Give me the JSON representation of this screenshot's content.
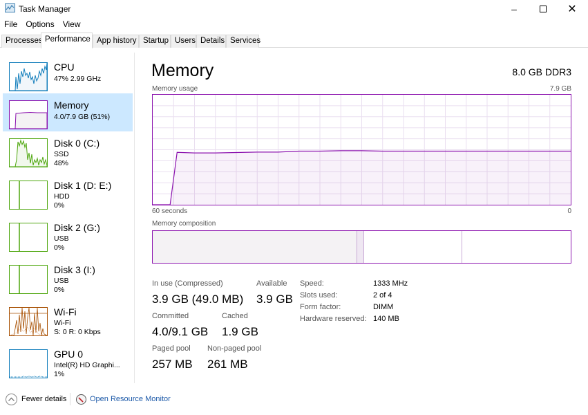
{
  "window": {
    "title": "Task Manager",
    "controls": [
      "minimize",
      "maximize",
      "close"
    ]
  },
  "menu": [
    "File",
    "Options",
    "View"
  ],
  "tabs": [
    {
      "label": "Processes",
      "active": false
    },
    {
      "label": "Performance",
      "active": true
    },
    {
      "label": "App history",
      "active": false
    },
    {
      "label": "Startup",
      "active": false
    },
    {
      "label": "Users",
      "active": false
    },
    {
      "label": "Details",
      "active": false
    },
    {
      "label": "Services",
      "active": false
    }
  ],
  "sidebar": {
    "items": [
      {
        "title": "CPU",
        "line1": "47% 2.99 GHz",
        "line2": "",
        "color": "#117dbb",
        "active": false
      },
      {
        "title": "Memory",
        "line1": "4.0/7.9 GB (51%)",
        "line2": "",
        "color": "#8b12ae",
        "active": true
      },
      {
        "title": "Disk 0 (C:)",
        "line1": "SSD",
        "line2": "48%",
        "color": "#4da60c",
        "active": false
      },
      {
        "title": "Disk 1 (D: E:)",
        "line1": "HDD",
        "line2": "0%",
        "color": "#4da60c",
        "active": false
      },
      {
        "title": "Disk 2 (G:)",
        "line1": "USB",
        "line2": "0%",
        "color": "#4da60c",
        "active": false
      },
      {
        "title": "Disk 3 (I:)",
        "line1": "USB",
        "line2": "0%",
        "color": "#4da60c",
        "active": false
      },
      {
        "title": "Wi-Fi",
        "line1": "Wi-Fi",
        "line2": "S: 0 R: 0 Kbps",
        "color": "#a74f01",
        "active": false
      },
      {
        "title": "GPU 0",
        "line1": "Intel(R) HD Graphi...",
        "line2": "1%",
        "color": "#117dbb",
        "active": false
      }
    ]
  },
  "main": {
    "title": "Memory",
    "spec": "8.0 GB DDR3",
    "usage_label": "Memory usage",
    "usage_max": "7.9 GB",
    "axis_left": "60 seconds",
    "axis_right": "0",
    "composition_label": "Memory composition",
    "stats": {
      "in_use_label": "In use (Compressed)",
      "in_use_value": "3.9 GB (49.0 MB)",
      "available_label": "Available",
      "available_value": "3.9 GB",
      "committed_label": "Committed",
      "committed_value": "4.0/9.1 GB",
      "cached_label": "Cached",
      "cached_value": "1.9 GB",
      "paged_label": "Paged pool",
      "paged_value": "257 MB",
      "nonpaged_label": "Non-paged pool",
      "nonpaged_value": "261 MB"
    },
    "details": [
      {
        "label": "Speed:",
        "value": "1333 MHz"
      },
      {
        "label": "Slots used:",
        "value": "2 of 4"
      },
      {
        "label": "Form factor:",
        "value": "DIMM"
      },
      {
        "label": "Hardware reserved:",
        "value": "140 MB"
      }
    ],
    "accent": "#8b12ae"
  },
  "footer": {
    "fewer_details": "Fewer details",
    "resource_monitor": "Open Resource Monitor"
  },
  "chart_data": {
    "type": "area",
    "title": "Memory usage",
    "xlabel": "60 seconds",
    "ylabel": "",
    "xlim": [
      60,
      0
    ],
    "ylim": [
      0,
      7.9
    ],
    "grid": true,
    "x": [
      60,
      57.5,
      56.5,
      54,
      51,
      48,
      45,
      42,
      39,
      36,
      33,
      30,
      27,
      24,
      21,
      18,
      15,
      12,
      9,
      6,
      3,
      0
    ],
    "values": [
      0,
      0,
      3.76,
      3.72,
      3.72,
      3.75,
      3.78,
      3.78,
      3.85,
      3.85,
      3.88,
      3.88,
      3.85,
      3.85,
      3.85,
      3.85,
      3.85,
      3.85,
      3.85,
      3.85,
      3.85,
      3.85
    ],
    "composition": {
      "in_use_fraction": 0.49,
      "modified_fraction": 0.015,
      "standby_fraction": 0.235,
      "free_fraction": 0.26
    }
  }
}
